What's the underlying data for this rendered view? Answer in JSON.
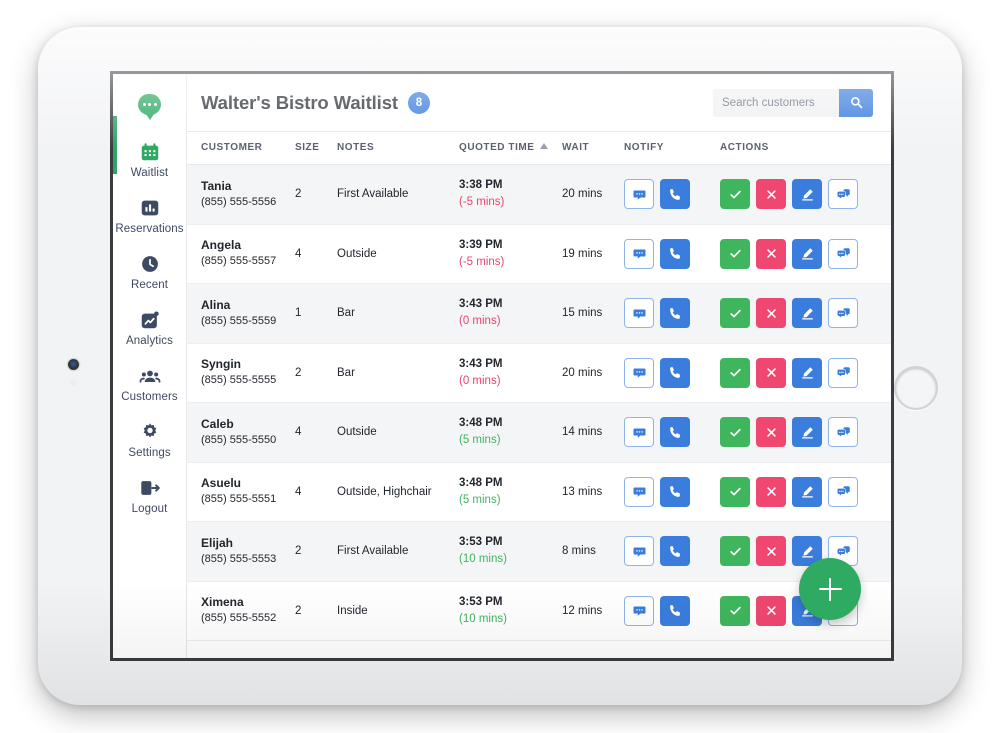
{
  "app": {
    "brand_icon": "chat-bubble-logo",
    "accent_green": "#2fa862",
    "accent_blue": "#3b7ddd",
    "late_color": "#e8456c",
    "early_color": "#3fb65d"
  },
  "sidebar": {
    "items": [
      {
        "label": "Waitlist",
        "icon": "calendar-icon",
        "active": true
      },
      {
        "label": "Reservations",
        "icon": "bar-chart-icon",
        "active": false
      },
      {
        "label": "Recent",
        "icon": "clock-icon",
        "active": false
      },
      {
        "label": "Analytics",
        "icon": "trend-up-icon",
        "active": false
      },
      {
        "label": "Customers",
        "icon": "people-icon",
        "active": false
      },
      {
        "label": "Settings",
        "icon": "gear-icon",
        "active": false
      },
      {
        "label": "Logout",
        "icon": "logout-icon",
        "active": false
      }
    ]
  },
  "header": {
    "title": "Walter's Bistro Waitlist",
    "count_badge": "8"
  },
  "search": {
    "placeholder": "Search customers",
    "value": "",
    "button_icon": "search-icon"
  },
  "table": {
    "columns": [
      {
        "key": "customer",
        "label": "CUSTOMER"
      },
      {
        "key": "size",
        "label": "SIZE"
      },
      {
        "key": "notes",
        "label": "NOTES"
      },
      {
        "key": "quoted_time",
        "label": "QUOTED TIME",
        "sorted": "asc"
      },
      {
        "key": "wait",
        "label": "WAIT"
      },
      {
        "key": "notify",
        "label": "NOTIFY"
      },
      {
        "key": "actions",
        "label": "ACTIONS"
      }
    ],
    "notify_buttons": [
      {
        "name": "sms-button",
        "icon": "chat-bubble-icon",
        "style": "outline"
      },
      {
        "name": "call-button",
        "icon": "phone-icon",
        "style": "blue"
      }
    ],
    "action_buttons": [
      {
        "name": "seat-button",
        "icon": "check-icon",
        "style": "green"
      },
      {
        "name": "remove-button",
        "icon": "close-icon",
        "style": "red"
      },
      {
        "name": "edit-button",
        "icon": "pencil-icon",
        "style": "blue"
      },
      {
        "name": "messages-button",
        "icon": "conversation-icon",
        "style": "outline"
      }
    ],
    "rows": [
      {
        "name": "Tania",
        "phone": "(855) 555-5556",
        "size": "2",
        "notes": "First Available",
        "quoted_time": "3:38 PM",
        "delta": "(-5 mins)",
        "delta_state": "late",
        "wait": "20 mins"
      },
      {
        "name": "Angela",
        "phone": "(855) 555-5557",
        "size": "4",
        "notes": "Outside",
        "quoted_time": "3:39 PM",
        "delta": "(-5 mins)",
        "delta_state": "late",
        "wait": "19 mins"
      },
      {
        "name": "Alina",
        "phone": "(855) 555-5559",
        "size": "1",
        "notes": "Bar",
        "quoted_time": "3:43 PM",
        "delta": "(0 mins)",
        "delta_state": "late",
        "wait": "15 mins"
      },
      {
        "name": "Syngin",
        "phone": "(855) 555-5555",
        "size": "2",
        "notes": "Bar",
        "quoted_time": "3:43 PM",
        "delta": "(0 mins)",
        "delta_state": "late",
        "wait": "20 mins"
      },
      {
        "name": "Caleb",
        "phone": "(855) 555-5550",
        "size": "4",
        "notes": "Outside",
        "quoted_time": "3:48 PM",
        "delta": "(5 mins)",
        "delta_state": "early",
        "wait": "14 mins"
      },
      {
        "name": "Asuelu",
        "phone": "(855) 555-5551",
        "size": "4",
        "notes": "Outside, Highchair",
        "quoted_time": "3:48 PM",
        "delta": "(5 mins)",
        "delta_state": "early",
        "wait": "13 mins"
      },
      {
        "name": "Elijah",
        "phone": "(855) 555-5553",
        "size": "2",
        "notes": "First Available",
        "quoted_time": "3:53 PM",
        "delta": "(10 mins)",
        "delta_state": "early",
        "wait": "8 mins"
      },
      {
        "name": "Ximena",
        "phone": "(855) 555-5552",
        "size": "2",
        "notes": "Inside",
        "quoted_time": "3:53 PM",
        "delta": "(10 mins)",
        "delta_state": "early",
        "wait": "12 mins"
      }
    ]
  },
  "fab": {
    "name": "add-party-button",
    "icon": "plus-icon"
  }
}
